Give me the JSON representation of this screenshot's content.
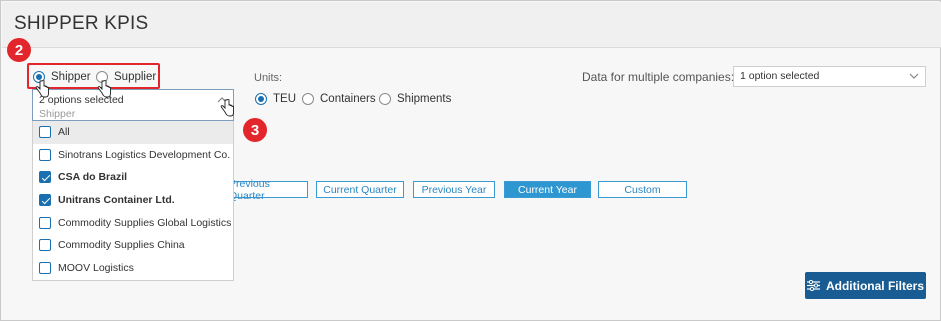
{
  "page": {
    "title": "SHIPPER KPIS"
  },
  "entity_type": {
    "options": [
      {
        "label": "Shipper",
        "selected": true
      },
      {
        "label": "Supplier",
        "selected": false
      }
    ]
  },
  "callouts": {
    "step_a": "2",
    "step_b": "3"
  },
  "units": {
    "label": "Units:",
    "options": [
      {
        "label": "TEU",
        "selected": true
      },
      {
        "label": "Containers",
        "selected": false
      },
      {
        "label": "Shipments",
        "selected": false
      }
    ]
  },
  "multi_company": {
    "label": "Data for multiple companies:",
    "value": "1 option selected"
  },
  "shipper_dropdown": {
    "selected_text": "2 options selected",
    "placeholder": "Shipper",
    "items": [
      {
        "label": "All",
        "checked": false
      },
      {
        "label": "Sinotrans Logistics Development Co. Ltd.",
        "checked": false
      },
      {
        "label": "CSA do Brazil",
        "checked": true
      },
      {
        "label": "Unitrans Container Ltd.",
        "checked": true
      },
      {
        "label": "Commodity Supplies Global Logistics (Sh",
        "checked": false
      },
      {
        "label": "Commodity Supplies China",
        "checked": false
      },
      {
        "label": "MOOV Logistics",
        "checked": false
      }
    ]
  },
  "periods": {
    "previous_quarter": "Previous Quarter",
    "current_quarter": "Current Quarter",
    "previous_year": "Previous Year",
    "current_year": "Current Year",
    "custom": "Custom",
    "active": "Current Year"
  },
  "filters": {
    "additional_label": "Additional Filters"
  },
  "colors": {
    "accent": "#1a6fb0",
    "callout": "#e3262b",
    "active_period": "#2e97d2",
    "primary_button": "#195c93"
  }
}
